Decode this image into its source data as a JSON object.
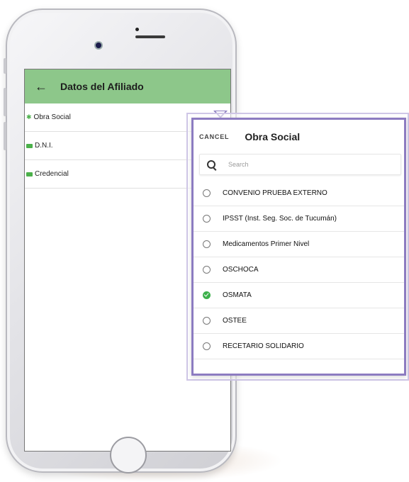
{
  "header": {
    "title": "Datos del Afiliado"
  },
  "form": {
    "fields": [
      {
        "label": "Obra Social"
      },
      {
        "label": "D.N.I."
      },
      {
        "label": "Credencial"
      }
    ]
  },
  "dialog": {
    "cancel_label": "CANCEL",
    "title": "Obra Social",
    "search": {
      "placeholder": "Search",
      "value": ""
    },
    "options": [
      {
        "label": "CONVENIO PRUEBA EXTERNO",
        "selected": false
      },
      {
        "label": "IPSST (Inst. Seg. Soc. de Tucumán)",
        "selected": false
      },
      {
        "label": "Medicamentos Primer Nivel",
        "selected": false
      },
      {
        "label": "OSCHOCA",
        "selected": false
      },
      {
        "label": "OSMATA",
        "selected": true
      },
      {
        "label": "OSTEE",
        "selected": false
      },
      {
        "label": "RECETARIO SOLIDARIO",
        "selected": false
      }
    ]
  },
  "colors": {
    "header_bg": "#8dc78a",
    "accent_green": "#3db04b",
    "dialog_border": "#8d7cc1"
  }
}
